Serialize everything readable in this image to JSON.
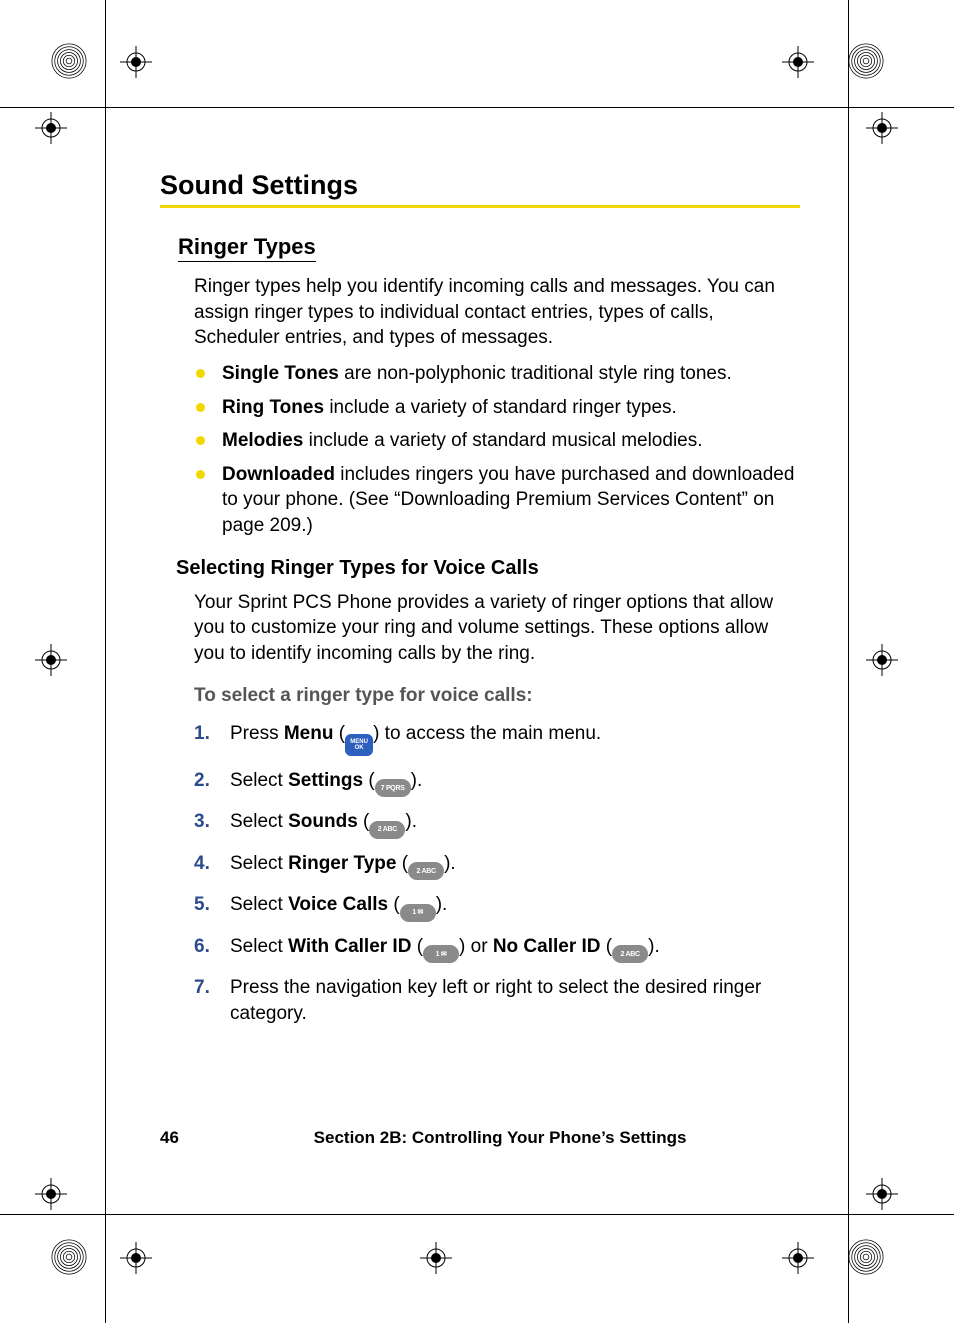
{
  "title": "Sound Settings",
  "section1": {
    "heading": "Ringer Types",
    "intro": "Ringer types help you identify incoming calls and messages. You can assign ringer types to individual contact entries, types of calls, Scheduler entries, and types of messages.",
    "bullets": [
      {
        "bold": "Single Tones",
        "rest": " are non-polyphonic traditional style ring tones."
      },
      {
        "bold": "Ring Tones",
        "rest": " include a variety of standard ringer types."
      },
      {
        "bold": "Melodies",
        "rest": " include a variety of standard musical melodies."
      },
      {
        "bold": "Downloaded",
        "rest": " includes ringers you have purchased and downloaded to your phone. (See “Downloading Premium Services Content” on page 209.)"
      }
    ]
  },
  "section2": {
    "heading": "Selecting Ringer Types for Voice Calls",
    "intro": "Your Sprint PCS Phone provides a variety of ringer options that allow you to customize your ring and volume settings. These options allow you to identify incoming calls by the ring.",
    "lead": "To select a ringer type for voice calls:",
    "steps": {
      "s1": {
        "num": "1.",
        "pre": "Press ",
        "bold": "Menu",
        "post": " (",
        "key_type": "menu",
        "key_label1": "MENU",
        "key_label2": "OK",
        "after": ") to access the main menu."
      },
      "s2": {
        "num": "2.",
        "pre": "Select ",
        "bold": "Settings",
        "post": " (",
        "key_type": "gray",
        "key_label": "7 PQRS",
        "after": ")."
      },
      "s3": {
        "num": "3.",
        "pre": "Select ",
        "bold": "Sounds",
        "post": " (",
        "key_type": "gray",
        "key_label": "2 ABC",
        "after": ")."
      },
      "s4": {
        "num": "4.",
        "pre": "Select ",
        "bold": "Ringer Type",
        "post": " (",
        "key_type": "gray",
        "key_label": "2 ABC",
        "after": ")."
      },
      "s5": {
        "num": "5.",
        "pre": "Select ",
        "bold": "Voice Calls",
        "post": " (",
        "key_type": "gray",
        "key_label": "1 ✉",
        "after": ")."
      },
      "s6": {
        "num": "6.",
        "pre": "Select ",
        "bold1": "With Caller ID",
        "mid1": " (",
        "key1_label": "1 ✉",
        "mid2": ") or ",
        "bold2": "No Caller ID",
        "mid3": " (",
        "key2_label": "2 ABC",
        "after": ")."
      },
      "s7": {
        "num": "7.",
        "text": "Press the navigation key left or right to select the desired ringer category."
      }
    }
  },
  "footer": {
    "page": "46",
    "section": "Section 2B: Controlling Your Phone’s Settings"
  },
  "marks": {
    "rosette": "registration-rosette-icon",
    "target": "registration-target-icon"
  }
}
